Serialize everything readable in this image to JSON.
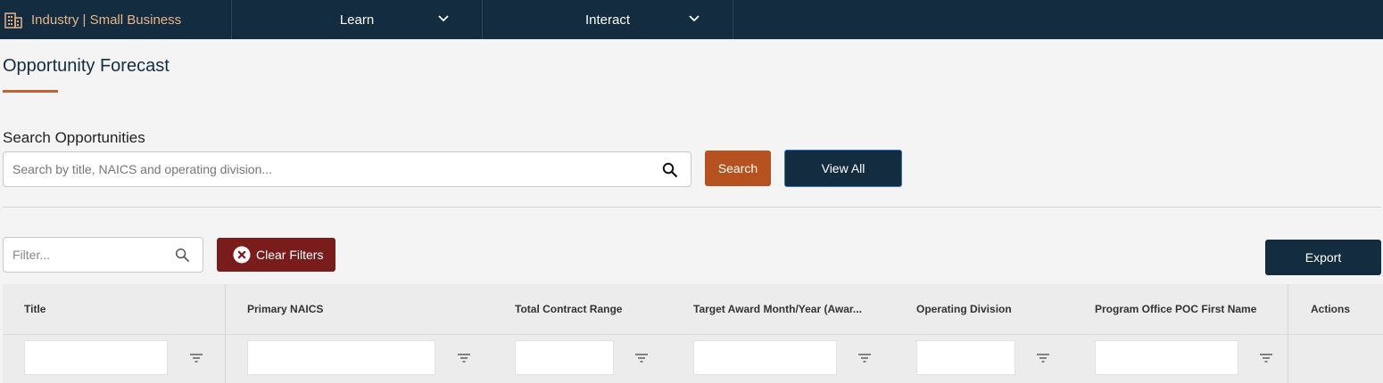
{
  "topnav": {
    "brand_label": "Industry | Small Business",
    "items": [
      {
        "label": "Learn"
      },
      {
        "label": "Interact"
      }
    ]
  },
  "page": {
    "title": "Opportunity Forecast"
  },
  "search": {
    "label": "Search Opportunities",
    "placeholder": "Search by title, NAICS and operating division...",
    "value": "",
    "search_button": "Search",
    "view_all_button": "View All"
  },
  "filters": {
    "placeholder": "Filter...",
    "clear_button": "Clear Filters",
    "export_button": "Export"
  },
  "grid": {
    "columns": [
      {
        "label": "Title"
      },
      {
        "label": "Primary NAICS"
      },
      {
        "label": "Total Contract Range"
      },
      {
        "label": "Target Award Month/Year (Awar..."
      },
      {
        "label": "Operating Division"
      },
      {
        "label": "Program Office POC First Name"
      },
      {
        "label": "Actions"
      }
    ]
  },
  "colors": {
    "nav_bg": "#132c3f",
    "accent_orange": "#b5521f",
    "clear_red": "#7a1c1c"
  }
}
